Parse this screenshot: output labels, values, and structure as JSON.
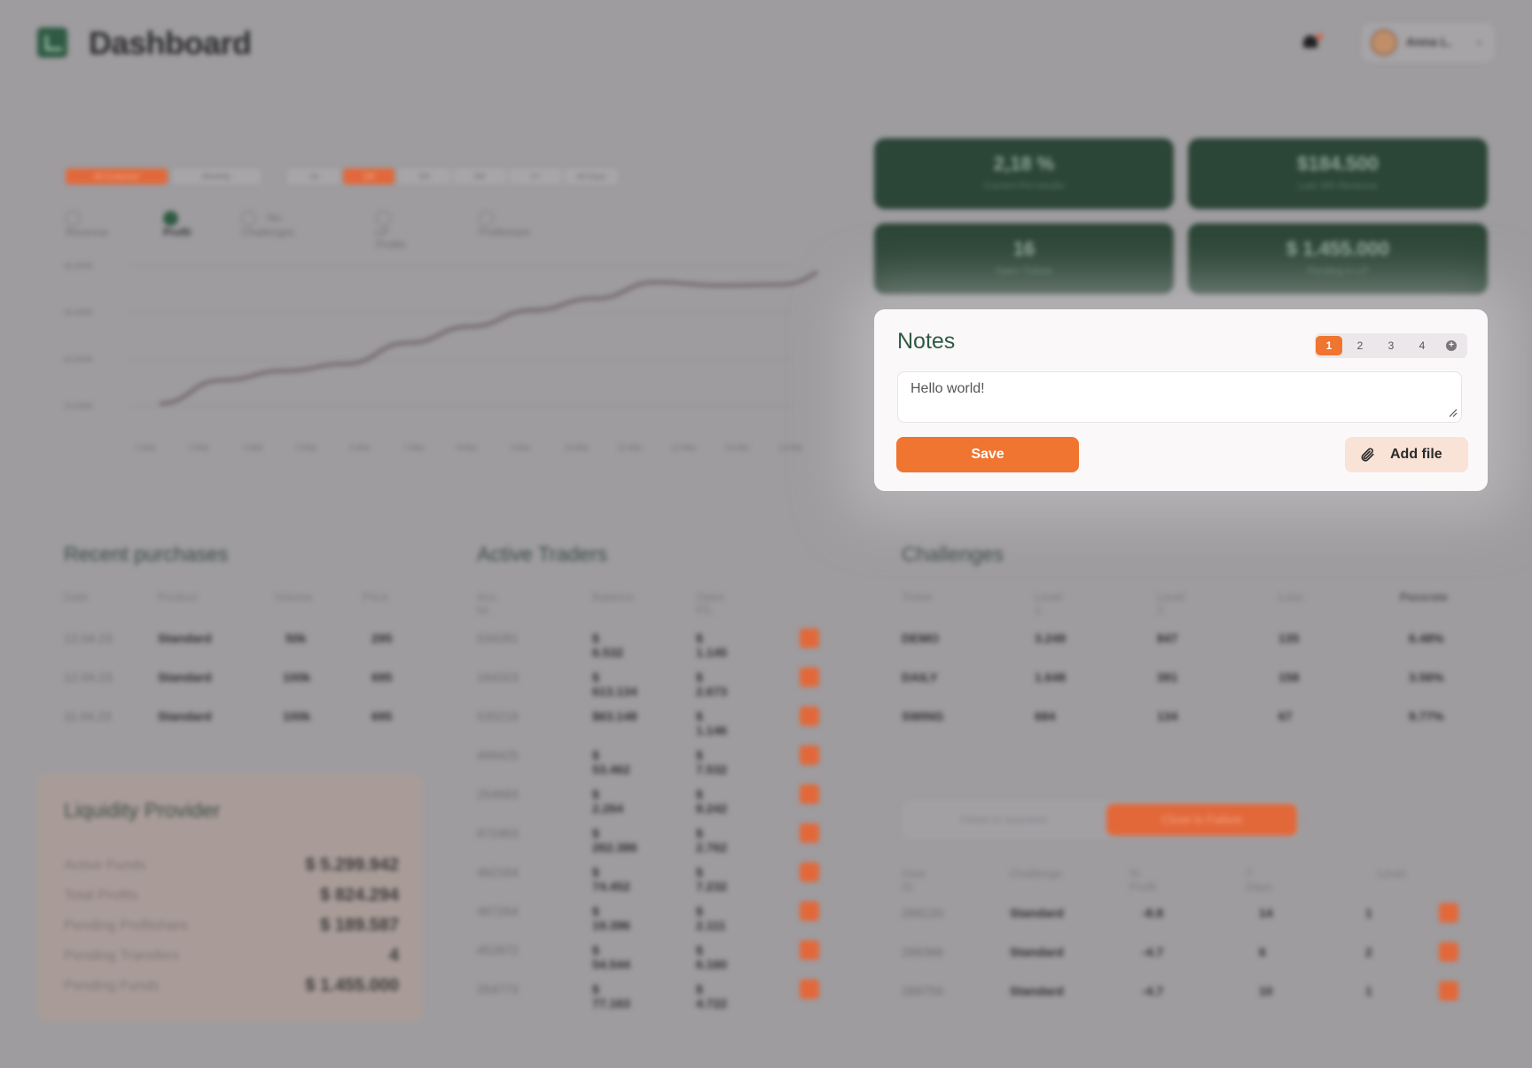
{
  "header": {
    "title": "Dashboard",
    "user_name": "Anna L.",
    "chevron": "⌄"
  },
  "chart_tabs": [
    "All Customer",
    "Monthly",
    "1d",
    "1W",
    "1M",
    "6M",
    "1Y",
    "All Days"
  ],
  "chart_series_toggles": [
    {
      "label": "Revenue",
      "checked": false
    },
    {
      "label": "Profit",
      "checked": true
    },
    {
      "label": "No. Challenges",
      "checked": false
    },
    {
      "label": "LP Profits",
      "checked": false
    },
    {
      "label": "Profitshare",
      "checked": false
    }
  ],
  "chart_data": {
    "type": "line",
    "x": [
      "2.Mar",
      "3.Mar",
      "4.Mar",
      "5.Mar",
      "6.Mar",
      "7.Mar",
      "8.Mar",
      "9.Mar",
      "10.Mar",
      "11.Mar",
      "12.Mar",
      "13.Mar",
      "14.Mar"
    ],
    "yticks": [
      "40,000€",
      "30,000€",
      "20,000€",
      "10,000€"
    ],
    "ylim": [
      10000,
      40000
    ],
    "series": [
      {
        "values": [
          10500,
          15500,
          17500,
          19000,
          23500,
          27000,
          30500,
          33000,
          36500,
          35800,
          36000,
          40000
        ]
      }
    ],
    "grid": true,
    "color": "#6e5f63"
  },
  "stats": [
    {
      "value": "2,18 %",
      "label": "Current Pnl results"
    },
    {
      "value": "$184.500",
      "label": "Last 30h Revenue"
    },
    {
      "value": "16",
      "label": "Open Tickets"
    },
    {
      "value": "$ 1.455.000",
      "label": "Pending in LP"
    }
  ],
  "notes": {
    "title": "Notes",
    "pages": [
      "1",
      "2",
      "3",
      "4"
    ],
    "active_page": "1",
    "add_page_icon": "+",
    "value": "Hello world!",
    "save_label": "Save",
    "add_file_label": "Add file"
  },
  "recent_purchases": {
    "title": "Recent purchases",
    "columns": [
      "Date",
      "Product",
      "Volume",
      "Price"
    ],
    "rows": [
      [
        "12.04.23",
        "Standard",
        "50k",
        "295"
      ],
      [
        "12.04.23",
        "Standard",
        "100k",
        "695"
      ],
      [
        "11.04.23",
        "Standard",
        "100k",
        "695"
      ]
    ]
  },
  "active_traders": {
    "title": "Active Traders",
    "columns": [
      "Acc. Nr.",
      "Balance",
      "Open P/L"
    ],
    "rows": [
      [
        "534281",
        "$ 6.532",
        "$ 1.145"
      ],
      [
        "164323",
        "$ 613.134",
        "$ 2.673"
      ],
      [
        "535218",
        "$63.148",
        "$ 1.146"
      ],
      [
        "468425",
        "$ 53.462",
        "$ 7.532"
      ],
      [
        "254683",
        "$ 2.264",
        "$ 8.242"
      ],
      [
        "872463",
        "$ 262.386",
        "$ 2.762"
      ],
      [
        "462164",
        "$ 74.452",
        "$ 7.232"
      ],
      [
        "467264",
        "$ 19.396",
        "$ 2.111"
      ],
      [
        "452872",
        "$ 54.544",
        "$ 6.160"
      ],
      [
        "254773",
        "$ 77.163",
        "$ 4.722"
      ]
    ]
  },
  "challenges": {
    "title": "Challenges",
    "columns": [
      "Ticker",
      "Level 1",
      "Level 2",
      "Loss",
      "Passrate"
    ],
    "rows": [
      [
        "DEMO",
        "3.249",
        "847",
        "135",
        "6.48%"
      ],
      [
        "DAILY",
        "1.648",
        "391",
        "158",
        "3.56%"
      ],
      [
        "SWING",
        "684",
        "134",
        "67",
        "9.77%"
      ]
    ]
  },
  "liquidity_provider": {
    "title": "Liquidity Provider",
    "rows": [
      [
        "Active Funds",
        "$ 5.299.942"
      ],
      [
        "Total Profits",
        "$ 824.294"
      ],
      [
        "Pending Profitshare",
        "$ 189.587"
      ],
      [
        "Pending Transfers",
        "4"
      ],
      [
        "Pending Funds",
        "$ 1.455.000"
      ]
    ]
  },
  "status_toggle": {
    "options": [
      "Close to success",
      "Close to Failure"
    ],
    "active": "Close to Failure"
  },
  "watchlist": {
    "columns": [
      "User ID",
      "Challenge",
      "% Profit",
      "?Days",
      "Level"
    ],
    "rows": [
      [
        "268120",
        "Standard",
        "-8.8",
        "14",
        "1"
      ],
      [
        "268368",
        "Standard",
        "-4.7",
        "6",
        "2"
      ],
      [
        "268759",
        "Standard",
        "-4.7",
        "10",
        "1"
      ]
    ]
  },
  "colors": {
    "accent": "#f07530",
    "brand_green": "#2f5a43",
    "stat_card": "#2b4536",
    "backdrop": "#9e9c9f"
  },
  "icons": {
    "logo": "chart-logo-icon",
    "bell": "bell-icon",
    "attach": "paperclip-icon",
    "row_action": "open-arrow-icon"
  }
}
